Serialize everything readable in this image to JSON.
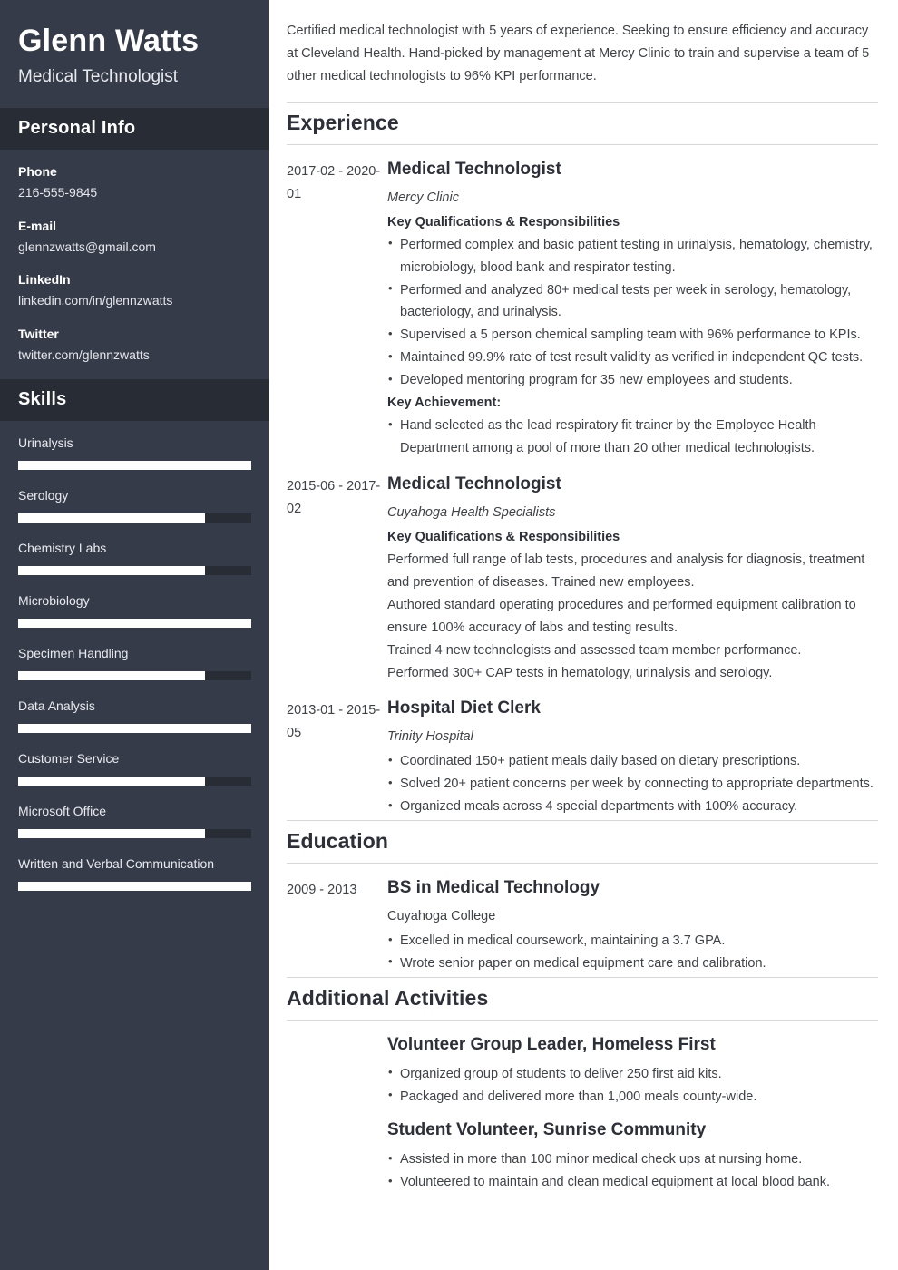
{
  "sidebar": {
    "full_name": "Glenn Watts",
    "job_title": "Medical Technologist",
    "personal_info_heading": "Personal Info",
    "contacts": [
      {
        "label": "Phone",
        "value": "216-555-9845"
      },
      {
        "label": "E-mail",
        "value": "glennzwatts@gmail.com"
      },
      {
        "label": "LinkedIn",
        "value": "linkedin.com/in/glennzwatts"
      },
      {
        "label": "Twitter",
        "value": "twitter.com/glennzwatts"
      }
    ],
    "skills_heading": "Skills",
    "skills": [
      {
        "name": "Urinalysis",
        "level": 100
      },
      {
        "name": "Serology",
        "level": 80
      },
      {
        "name": "Chemistry Labs",
        "level": 80
      },
      {
        "name": "Microbiology",
        "level": 100
      },
      {
        "name": "Specimen Handling",
        "level": 80
      },
      {
        "name": "Data Analysis",
        "level": 100
      },
      {
        "name": "Customer Service",
        "level": 80
      },
      {
        "name": "Microsoft Office",
        "level": 80
      },
      {
        "name": "Written and Verbal Communication",
        "level": 100
      }
    ]
  },
  "main": {
    "summary": "Certified medical technologist with 5 years of experience. Seeking to ensure efficiency and accuracy at Cleveland Health. Hand-picked by management at Mercy Clinic to train and supervise a team of 5 other medical technologists to 96% KPI performance.",
    "experience_heading": "Experience",
    "experience": [
      {
        "dates": "2017-02 - 2020-01",
        "title": "Medical Technologist",
        "org": "Mercy Clinic",
        "subhead": "Key Qualifications & Responsibilities",
        "bullets": [
          "Performed complex and basic patient testing in urinalysis, hematology, chemistry, microbiology, blood bank and respirator testing.",
          "Performed and analyzed 80+ medical tests per week in serology, hematology, bacteriology, and urinalysis.",
          "Supervised a 5 person chemical sampling team with 96% performance to KPIs.",
          "Maintained 99.9% rate of test result validity as verified in independent QC tests.",
          "Developed mentoring program for 35 new employees and students."
        ],
        "subhead2": "Key Achievement:",
        "bullets2": [
          "Hand selected as the lead respiratory fit trainer by the Employee Health Department among a pool of more than 20 other medical technologists."
        ]
      },
      {
        "dates": "2015-06 - 2017-02",
        "title": "Medical Technologist",
        "org": "Cuyahoga Health Specialists",
        "subhead": "Key Qualifications & Responsibilities",
        "paragraphs": [
          "Performed full range of lab tests, procedures and analysis for diagnosis, treatment and prevention of diseases. Trained new employees.",
          "Authored standard operating procedures and performed equipment calibration to ensure 100% accuracy of labs and testing results.",
          "Trained 4 new technologists and assessed team member performance.",
          "Performed 300+ CAP tests in hematology, urinalysis and serology."
        ]
      },
      {
        "dates": "2013-01 - 2015-05",
        "title": "Hospital Diet Clerk",
        "org": "Trinity Hospital",
        "bullets": [
          "Coordinated 150+ patient meals daily based on dietary prescriptions.",
          "Solved 20+ patient concerns per week by connecting to appropriate departments.",
          "Organized meals across 4 special departments with 100% accuracy."
        ]
      }
    ],
    "education_heading": "Education",
    "education": [
      {
        "dates": "2009 - 2013",
        "title": "BS in Medical Technology",
        "org": "Cuyahoga College",
        "bullets": [
          "Excelled in medical coursework, maintaining a 3.7 GPA.",
          "Wrote senior paper on medical equipment care and calibration."
        ]
      }
    ],
    "activities_heading": "Additional Activities",
    "activities": [
      {
        "title": "Volunteer Group Leader, Homeless First",
        "bullets": [
          "Organized group of students to deliver 250 first aid kits.",
          "Packaged and delivered more than 1,000 meals county-wide."
        ]
      },
      {
        "title": "Student Volunteer, Sunrise Community",
        "bullets": [
          "Assisted in more than 100 minor medical check ups at nursing home.",
          "Volunteered to maintain and clean medical equipment at local blood bank."
        ]
      }
    ]
  }
}
